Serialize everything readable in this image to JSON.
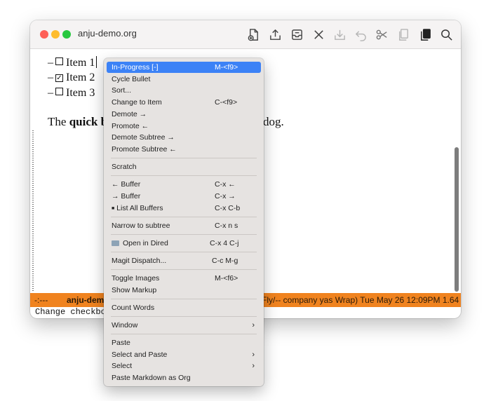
{
  "window": {
    "title": "anju-demo.org"
  },
  "content": {
    "items": [
      {
        "dash": "–",
        "checked": false,
        "label": "Item 1"
      },
      {
        "dash": "–",
        "checked": true,
        "label": "Item 2"
      },
      {
        "dash": "–",
        "checked": false,
        "label": "Item 3"
      }
    ],
    "para_the": "The",
    "para_bold": "quick b",
    "para_end": "dog."
  },
  "modeline": {
    "left": "-:---",
    "buffer": "anju-dem",
    "right": "Fly/-- company yas Wrap)  Tue May 26 12:09PM 1.64"
  },
  "echo": "Change checkbox",
  "menu": {
    "items": [
      {
        "label": "In-Progress [-]",
        "shortcut": "M-<f9>",
        "selected": true
      },
      {
        "label": "Cycle Bullet",
        "shortcut": ""
      },
      {
        "label": "Sort...",
        "shortcut": ""
      },
      {
        "label": "Change to Item",
        "shortcut": "C-<f9>"
      },
      {
        "label": "Demote →",
        "shortcut": ""
      },
      {
        "label": "Promote ←",
        "shortcut": ""
      },
      {
        "label": "Demote Subtree →",
        "shortcut": ""
      },
      {
        "label": "Promote Subtree ←",
        "shortcut": ""
      },
      {
        "label": "Scratch",
        "shortcut": ""
      },
      {
        "label": "← Buffer",
        "shortcut": "C-x ←"
      },
      {
        "label": "→ Buffer",
        "shortcut": "C-x →"
      },
      {
        "label": "List All Buffers",
        "shortcut": "C-x C-b"
      },
      {
        "label": "Narrow to subtree",
        "shortcut": "C-x n s"
      },
      {
        "label": "Open in Dired",
        "shortcut": "C-x 4 C-j"
      },
      {
        "label": "Magit Dispatch...",
        "shortcut": "C-c M-g"
      },
      {
        "label": "Toggle Images",
        "shortcut": "M-<f6>"
      },
      {
        "label": "Show Markup",
        "shortcut": ""
      },
      {
        "label": "Count Words",
        "shortcut": ""
      },
      {
        "label": "Window",
        "shortcut": "",
        "submenu": true
      },
      {
        "label": "Paste",
        "shortcut": ""
      },
      {
        "label": "Select and Paste",
        "shortcut": "",
        "submenu": true
      },
      {
        "label": "Select",
        "shortcut": "",
        "submenu": true
      },
      {
        "label": "Paste Markdown as Org",
        "shortcut": ""
      }
    ],
    "submenu_glyph": "›",
    "list_glyph": "■",
    "folder_icon": "folder-icon"
  },
  "colors": {
    "accent": "#3c82f6",
    "modeline": "#f0831f",
    "menu_bg": "#e6e3e1"
  },
  "toolbar": {
    "icons": [
      "new-file-icon",
      "upload-icon",
      "inbox-icon",
      "close-icon",
      "download-icon",
      "undo-icon",
      "cut-icon",
      "copy-icon",
      "paste-icon",
      "search-icon"
    ]
  }
}
